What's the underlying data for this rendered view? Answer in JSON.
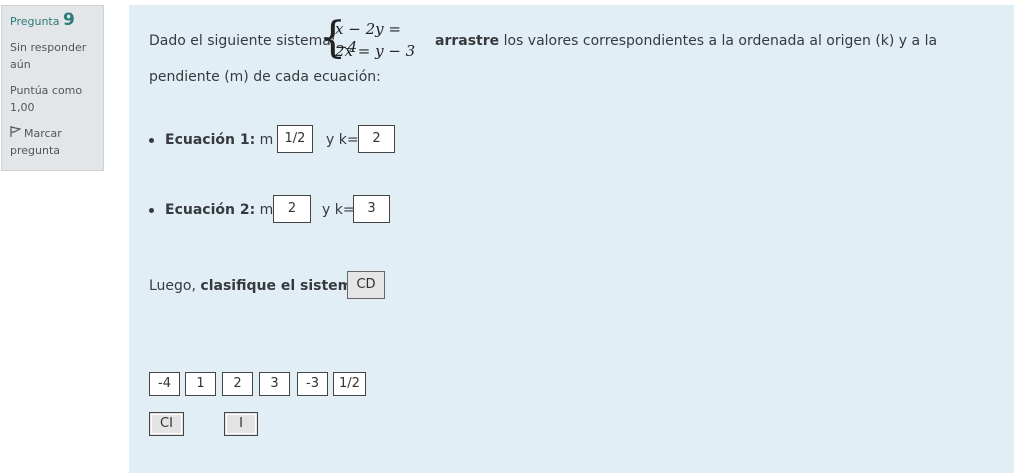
{
  "info": {
    "question_label": "Pregunta",
    "question_number": "9",
    "status": "Sin responder aún",
    "points": "Puntúa como 1,00",
    "flag_label": "Marcar pregunta"
  },
  "question": {
    "intro": "Dado el siguiente sistema:",
    "eq1": "x − 2y = −4",
    "eq2": "2x = y − 3",
    "bold_word": "arrastre",
    "rest_line1": "los valores correspondientes a la ordenada al origen (k) y a la",
    "line2": "pendiente (m) de cada ecuación:",
    "eq1_label": "Ecuación 1:",
    "eq1_m_label": "m =",
    "eq1_m_value": "1/2",
    "eq1_k_label": "y k=",
    "eq1_k_value": "2",
    "eq2_label": "Ecuación 2:",
    "eq2_m_label": "m=",
    "eq2_m_value": "2",
    "eq2_k_label": "y k=",
    "eq2_k_value": "3",
    "classify_prefix": "Luego, ",
    "classify_bold": "clasifique el sistema",
    "classify_colon": ":",
    "classify_value": "CD"
  },
  "choices": [
    "-4",
    "1",
    "2",
    "3",
    "-3",
    "1/2"
  ],
  "classify_choices": [
    "CI",
    "I"
  ]
}
